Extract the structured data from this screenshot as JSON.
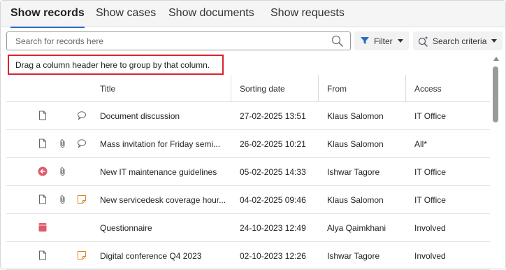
{
  "tabs": [
    {
      "label": "Show records",
      "active": true
    },
    {
      "label": "Show cases",
      "active": false
    },
    {
      "label": "Show documents",
      "active": false
    },
    {
      "label": "Show requests",
      "active": false
    }
  ],
  "search": {
    "placeholder": "Search for records here",
    "value": ""
  },
  "toolbar": {
    "filter_label": "Filter",
    "criteria_label": "Search criteria"
  },
  "group_hint": "Drag a column header here to group by that column.",
  "columns": {
    "title": "Title",
    "sorting_date": "Sorting date",
    "from": "From",
    "access": "Access"
  },
  "rows": [
    {
      "type_icon": "document-icon",
      "attachment": false,
      "extra_icon": "comment-icon",
      "title": "Document discussion",
      "date": "27-02-2025 13:51",
      "from": "Klaus Salomon",
      "access": "IT Office"
    },
    {
      "type_icon": "document-icon",
      "attachment": true,
      "extra_icon": "comment-icon",
      "title": "Mass invitation for Friday semi...",
      "date": "26-02-2025 10:21",
      "from": "Klaus Salomon",
      "access": "All*"
    },
    {
      "type_icon": "incoming-mail-icon",
      "attachment": true,
      "extra_icon": "",
      "title": "New IT maintenance guidelines",
      "date": "05-02-2025 14:33",
      "from": "Ishwar Tagore",
      "access": "IT Office"
    },
    {
      "type_icon": "document-icon",
      "attachment": true,
      "extra_icon": "note-icon",
      "title": "New servicedesk coverage hour...",
      "date": "04-02-2025 09:46",
      "from": "Klaus Salomon",
      "access": "IT Office"
    },
    {
      "type_icon": "form-icon",
      "attachment": false,
      "extra_icon": "",
      "title": "Questionnaire",
      "date": "24-10-2023 12:49",
      "from": "Alya Qaimkhani",
      "access": "Involved"
    },
    {
      "type_icon": "document-icon",
      "attachment": false,
      "extra_icon": "note-icon",
      "title": "Digital conference Q4 2023",
      "date": "02-10-2023 12:26",
      "from": "Ishwar Tagore",
      "access": "Involved"
    }
  ],
  "colors": {
    "accent": "#2b6cc4",
    "highlight_border": "#d9232e",
    "incoming_icon": "#e05a6a",
    "note_icon": "#d98a2b"
  }
}
